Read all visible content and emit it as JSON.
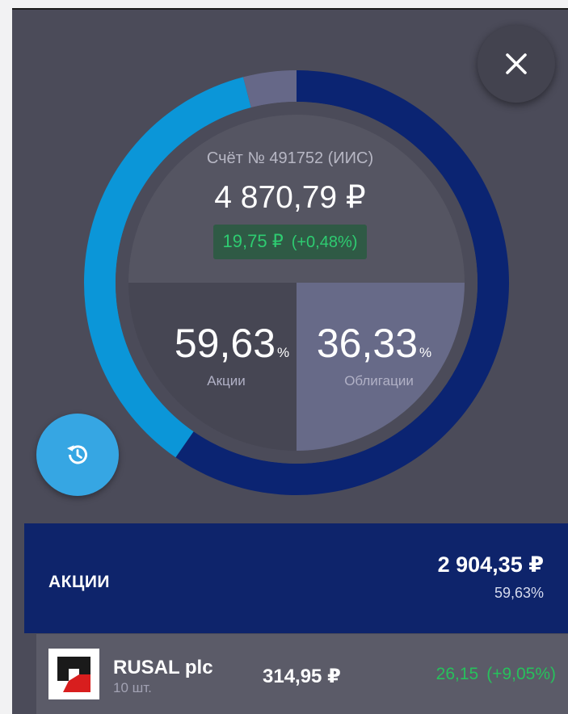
{
  "portfolio": {
    "account": "Счёт № 491752 (ИИС)",
    "total": "4 870,79 ₽",
    "change_value": "19,75 ₽",
    "change_percent": "(+0,48%)"
  },
  "allocation": {
    "segments": [
      {
        "label": "Акции",
        "value": "59,63",
        "percent": 59.63,
        "color": "#0b2472"
      },
      {
        "label": "Облигации",
        "value": "36,33",
        "percent": 36.33,
        "color": "#0b96d8"
      },
      {
        "label": "",
        "percent": 4.04,
        "color": "#666888"
      }
    ],
    "percent_symbol": "%",
    "center_colors": {
      "top": "#555562",
      "stocks": "#464653",
      "bonds": "#676a88"
    }
  },
  "section": {
    "title": "АКЦИИ",
    "sum": "2 904,35 ₽",
    "percent": "59,63%"
  },
  "assets": [
    {
      "name": "RUSAL plc",
      "qty": "10 шт.",
      "price": "314,95 ₽",
      "change": "26,15",
      "change_percent": "(+9,05%)",
      "logo": "rusal-logo"
    }
  ],
  "icons": {
    "close": "close-icon",
    "history": "history-icon"
  },
  "colors": {
    "background": "#4b4b59",
    "accent": "#36a6e3",
    "positive": "#27c15c",
    "section": "#0e246b"
  }
}
